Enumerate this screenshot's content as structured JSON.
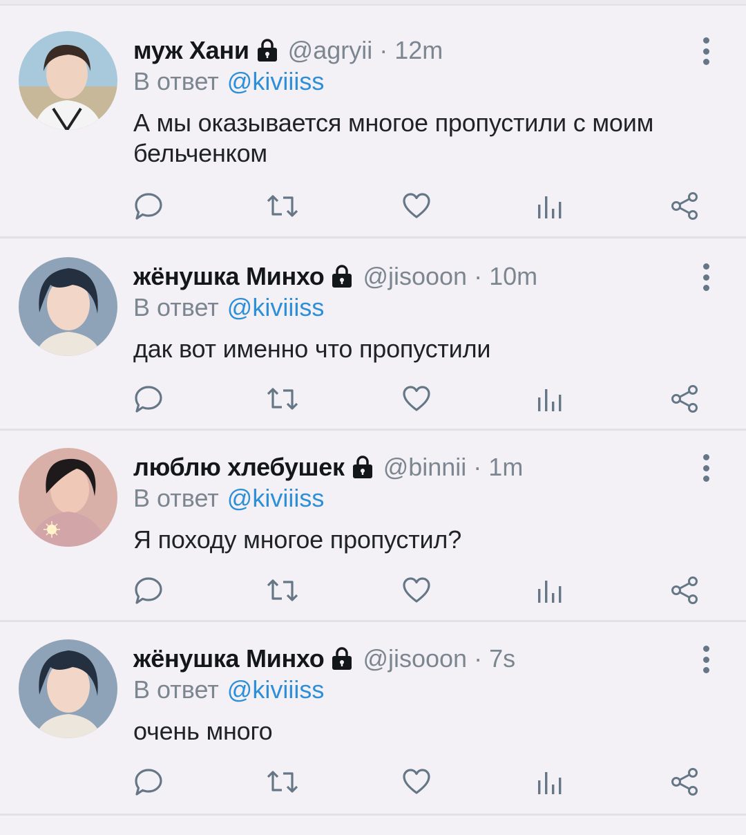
{
  "tweets": [
    {
      "name": "муж Хани",
      "handle": "@agryii",
      "separator": "·",
      "time": "12m",
      "reply_prefix": "В ответ",
      "reply_mention": "@kiviiiss",
      "text": "А мы оказывается многое пропустили с моим бельченком",
      "avatar_colors": {
        "bg": "#a8c8dc",
        "skin": "#f0d2c0",
        "hair": "#3a2c24",
        "cloth": "#f4f4f4"
      }
    },
    {
      "name": "жёнушка Минхо",
      "handle": "@jisooon",
      "separator": "·",
      "time": "10m",
      "reply_prefix": "В ответ",
      "reply_mention": "@kiviiiss",
      "text": "дак вот именно что пропустили",
      "avatar_colors": {
        "bg": "#8fa3b8",
        "skin": "#f2d6c8",
        "hair": "#243040",
        "cloth": "#ece6dc"
      }
    },
    {
      "name": "люблю хлебушек",
      "handle": "@binnii",
      "separator": "·",
      "time": "1m",
      "reply_prefix": "В ответ",
      "reply_mention": "@kiviiiss",
      "text": "Я походу многое пропустил?",
      "avatar_colors": {
        "bg": "#d8b0a8",
        "skin": "#f0c8b8",
        "hair": "#1e1a1c",
        "cloth": "#d2a6a8"
      }
    },
    {
      "name": "жёнушка Минхо",
      "handle": "@jisooon",
      "separator": "·",
      "time": "7s",
      "reply_prefix": "В ответ",
      "reply_mention": "@kiviiiss",
      "text": "очень много",
      "avatar_colors": {
        "bg": "#8fa3b8",
        "skin": "#f2d6c8",
        "hair": "#243040",
        "cloth": "#ece6dc"
      }
    }
  ],
  "icons": {
    "lock": "lock-icon",
    "more": "more-options-icon",
    "reply": "reply-icon",
    "retweet": "retweet-icon",
    "like": "heart-icon",
    "analytics": "analytics-icon",
    "share": "share-icon"
  },
  "colors": {
    "background": "#f4f1f6",
    "name": "#14171a",
    "meta": "#7c8690",
    "mention": "#2c8fd8",
    "icon": "#657786"
  }
}
